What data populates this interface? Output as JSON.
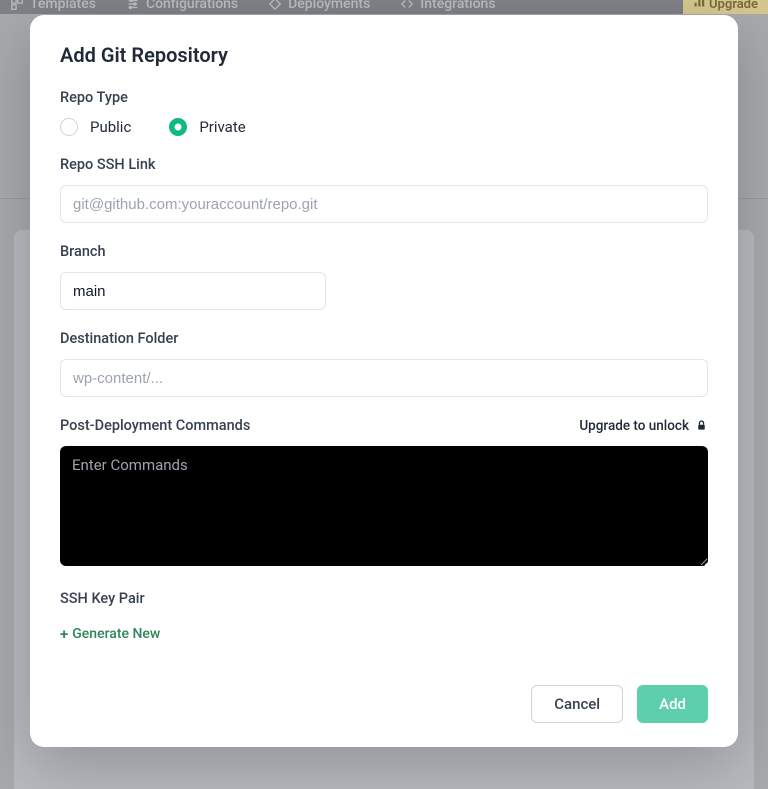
{
  "nav": {
    "items": [
      {
        "label": "Templates"
      },
      {
        "label": "Configurations"
      },
      {
        "label": "Deployments"
      },
      {
        "label": "Integrations"
      }
    ],
    "upgrade": "Upgrade"
  },
  "modal": {
    "title": "Add Git Repository",
    "repo_type": {
      "label": "Repo Type",
      "public": "Public",
      "private": "Private",
      "selected": "private"
    },
    "ssh_link": {
      "label": "Repo SSH Link",
      "placeholder": "git@github.com:youraccount/repo.git",
      "value": ""
    },
    "branch": {
      "label": "Branch",
      "value": "main"
    },
    "destination": {
      "label": "Destination Folder",
      "placeholder": "wp-content/...",
      "value": ""
    },
    "post_deploy": {
      "label": "Post-Deployment Commands",
      "upgrade_text": "Upgrade to unlock",
      "placeholder": "Enter Commands",
      "value": ""
    },
    "ssh_key": {
      "label": "SSH Key Pair",
      "generate": "Generate New"
    },
    "footer": {
      "cancel": "Cancel",
      "add": "Add"
    }
  }
}
